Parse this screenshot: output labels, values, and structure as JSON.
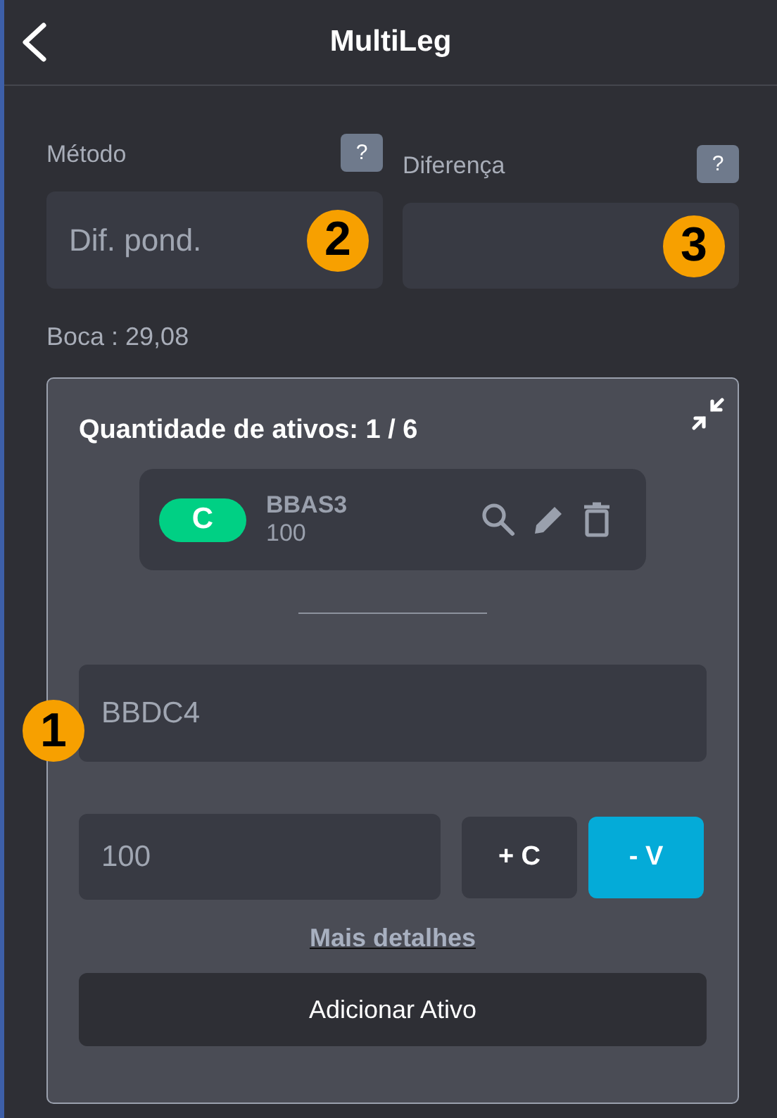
{
  "header": {
    "title": "MultiLeg"
  },
  "fields": [
    {
      "label": "Método",
      "help": "?",
      "value": "Dif. pond."
    },
    {
      "label": "Diferença",
      "help": "?"
    }
  ],
  "boca": "Boca : 29,08",
  "card": {
    "title": "Quantidade de ativos: 1 / 6",
    "assets": [
      {
        "side": "C",
        "color": "#00d084",
        "ticker": "BBAS3",
        "quantity": "100"
      }
    ],
    "ticker_field": {
      "placeholder": "BBDC4"
    },
    "quantity_field": {
      "placeholder": "100"
    },
    "sides": [
      {
        "label": "+ C",
        "selected": false
      },
      {
        "label": "- V",
        "selected": true
      }
    ],
    "details_link": "Mais detalhes",
    "add_button": "Adicionar Ativo"
  },
  "markers": [
    {
      "label": "2",
      "kind": "method"
    },
    {
      "label": "3",
      "kind": "difference"
    },
    {
      "label": "1",
      "kind": "ticker"
    }
  ]
}
